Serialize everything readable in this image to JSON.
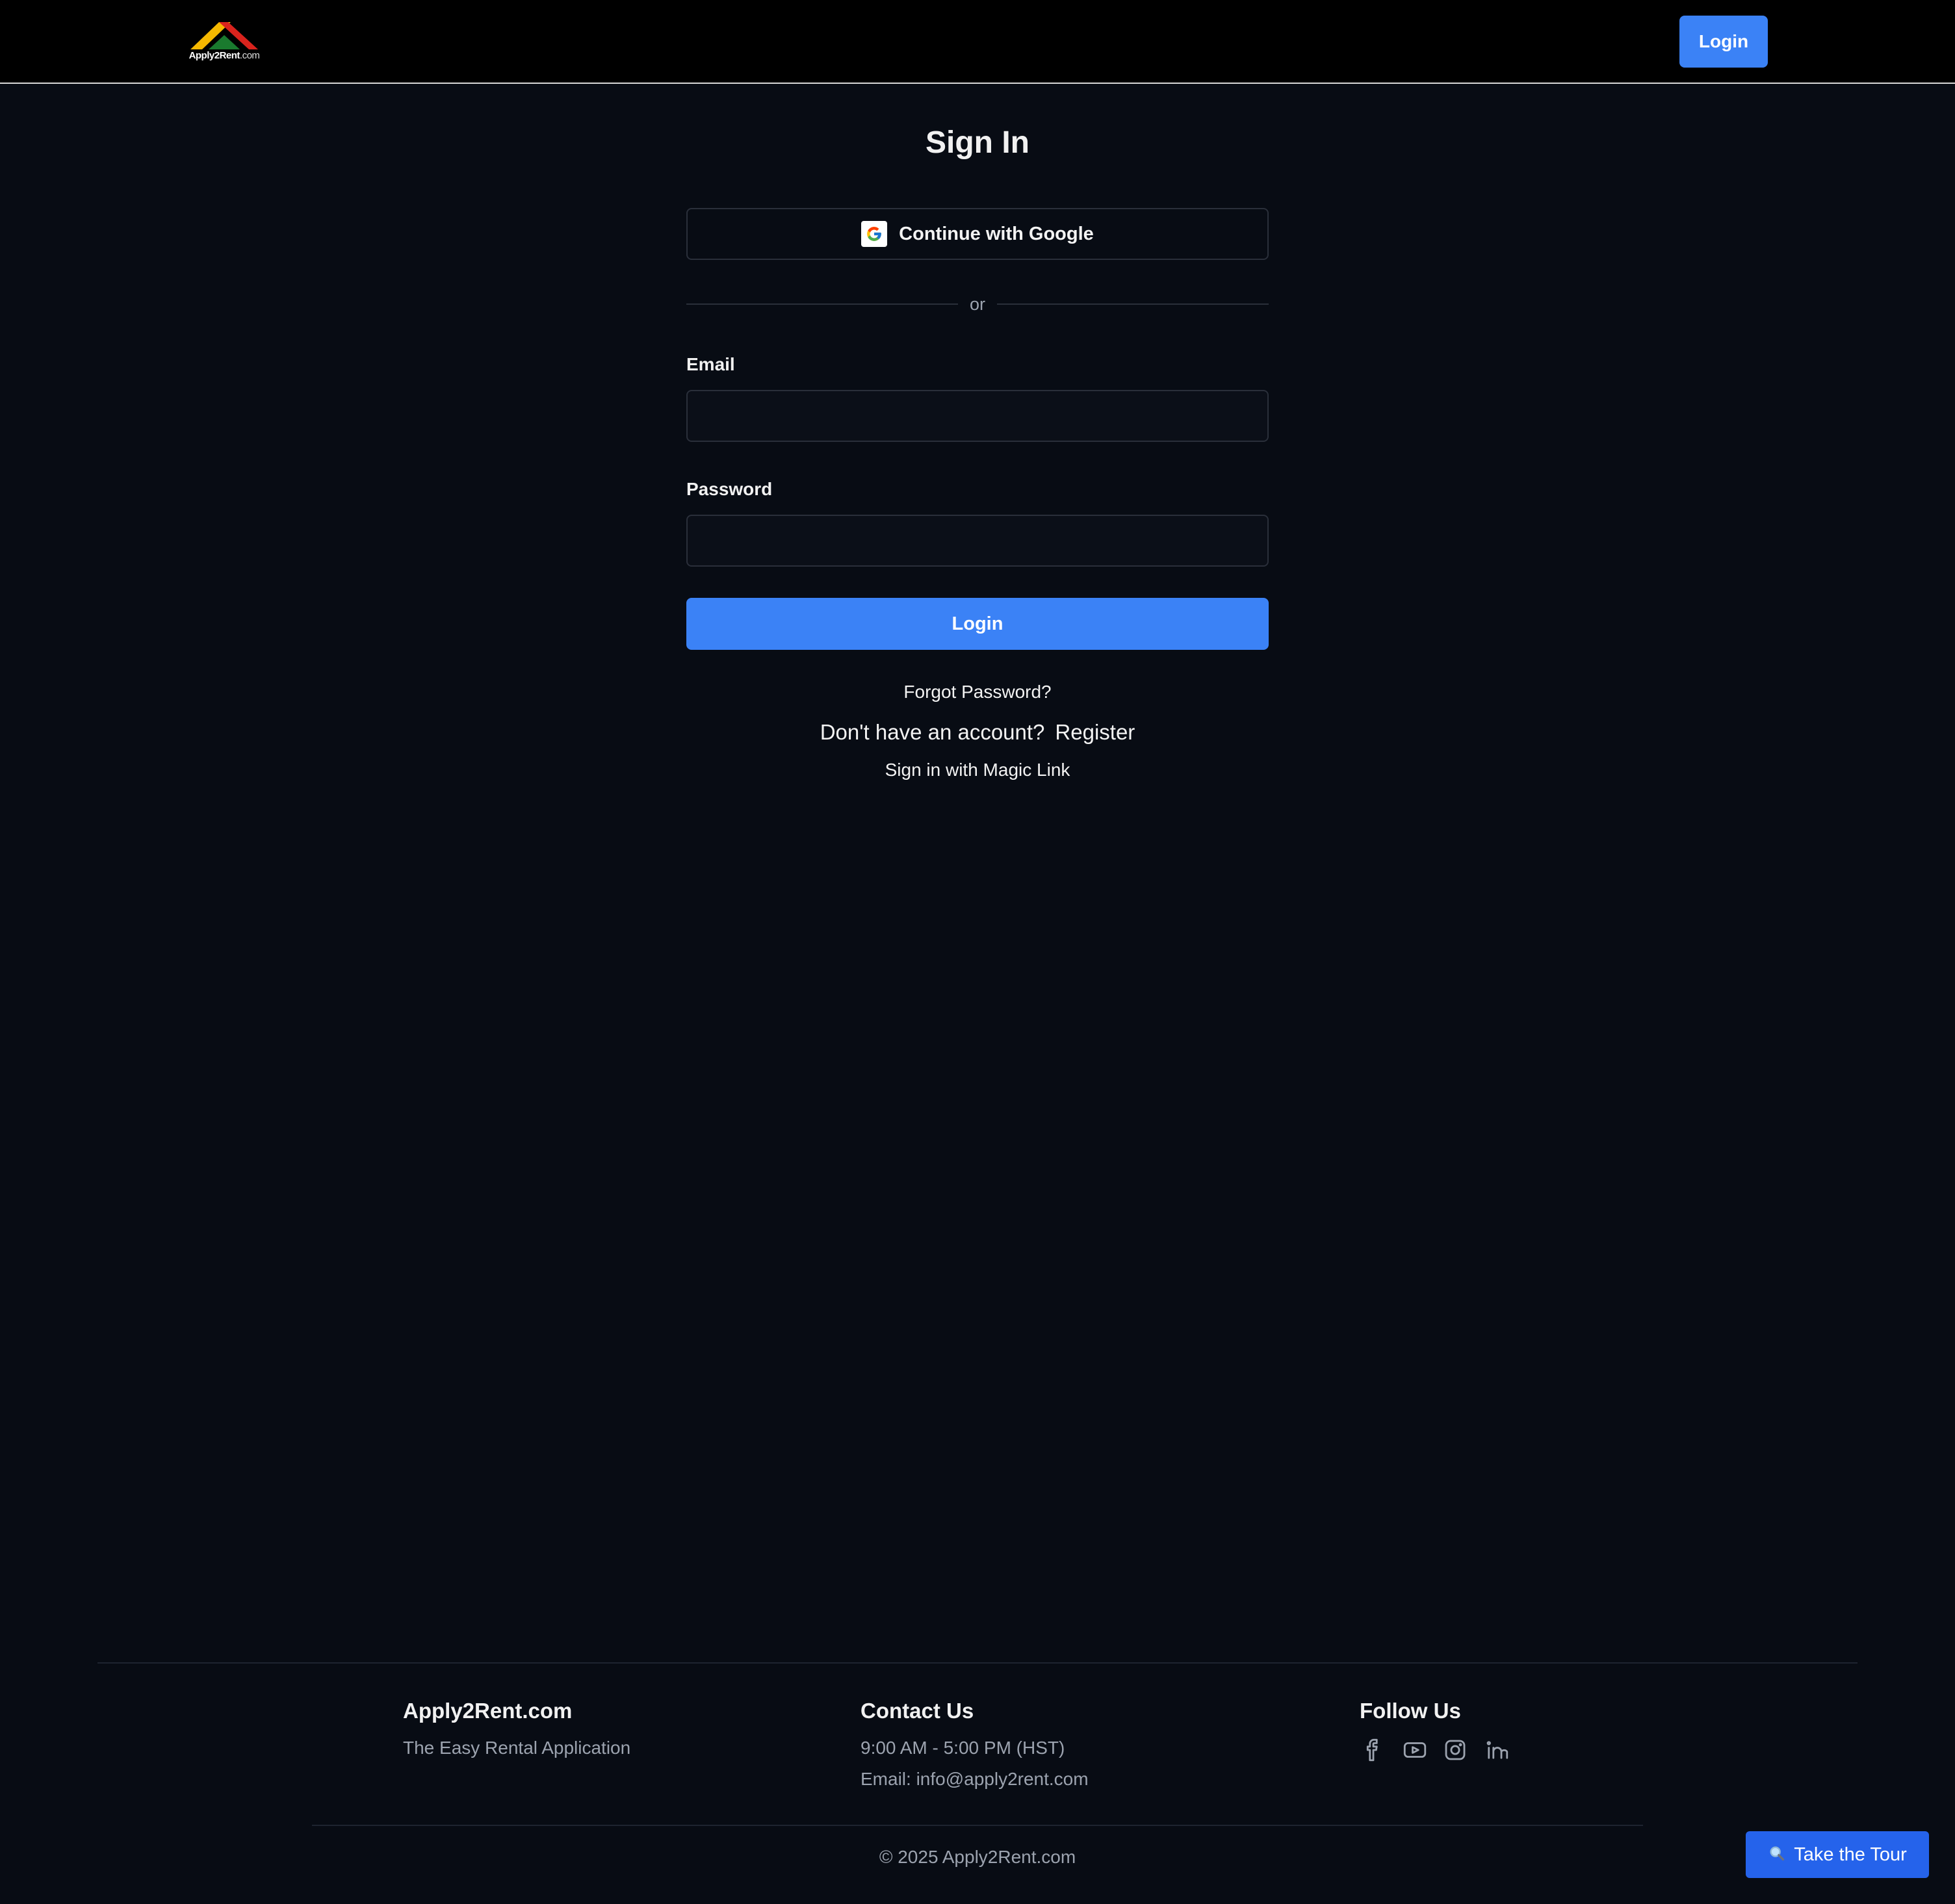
{
  "header": {
    "logo_text": "Apply2Rent",
    "logo_suffix": ".com",
    "login_label": "Login"
  },
  "signin": {
    "title": "Sign In",
    "google_label": "Continue with Google",
    "divider_text": "or",
    "email_label": "Email",
    "email_value": "",
    "password_label": "Password",
    "password_value": "",
    "login_label": "Login",
    "forgot_label": "Forgot Password?",
    "no_account_text": "Don't have an account?",
    "register_label": "Register",
    "magic_link_label": "Sign in with Magic Link"
  },
  "footer": {
    "brand_title": "Apply2Rent.com",
    "brand_tagline": "The Easy Rental Application",
    "contact_title": "Contact Us",
    "contact_hours": "9:00 AM - 5:00 PM (HST)",
    "contact_email": "Email: info@apply2rent.com",
    "follow_title": "Follow Us",
    "social_icons": [
      "facebook-icon",
      "youtube-icon",
      "instagram-icon",
      "linkedin-icon"
    ],
    "copyright": "© 2025 Apply2Rent.com"
  },
  "tour": {
    "icon": "magnifier-icon",
    "label": "Take the Tour"
  },
  "colors": {
    "accent": "#3b82f6",
    "tour_button": "#2563eb",
    "background": "#080c14",
    "header_background": "#000000",
    "muted_text": "#9ca3af"
  }
}
